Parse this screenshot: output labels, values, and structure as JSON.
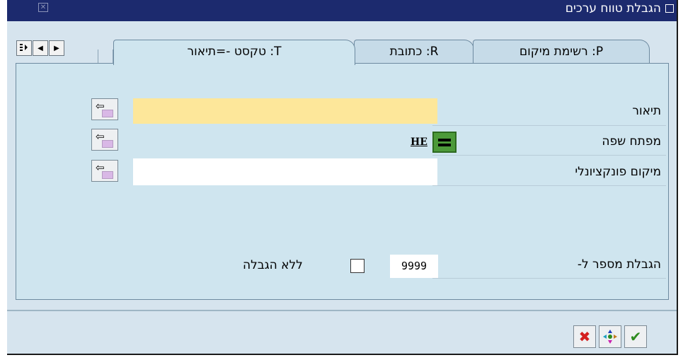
{
  "window": {
    "title": "הגבלת טווח ערכים"
  },
  "tabs": [
    {
      "label": "P: רשימת מיקום",
      "active": false
    },
    {
      "label": "R: כתובת",
      "active": false
    },
    {
      "label": "T: טקסט -=תיאור",
      "active": true
    }
  ],
  "form": {
    "description": {
      "label": "תיאור",
      "value": ""
    },
    "language_key": {
      "label": "מפתח שפה",
      "value": "HE"
    },
    "functional_location": {
      "label": "מיקום פונקציונלי",
      "value": ""
    },
    "max_hits": {
      "label": "הגבלת מספר ל-",
      "value": "9999"
    },
    "no_limit": {
      "label": "ללא הגבלה",
      "checked": false
    }
  },
  "icons": {
    "nav": [
      "menu-list-icon",
      "scroll-left-icon",
      "scroll-right-icon"
    ],
    "match_button": "multiple-selection-arrow-icon",
    "language_button": "equals-icon",
    "footer": [
      "cancel-icon",
      "multiple-selection-icon",
      "continue-check-icon"
    ]
  },
  "colors": {
    "titlebar": "#1c2a6e",
    "required_field": "#fde79a",
    "panel": "#cfe5ef",
    "cancel": "#d42020",
    "confirm": "#2e8b1f"
  }
}
